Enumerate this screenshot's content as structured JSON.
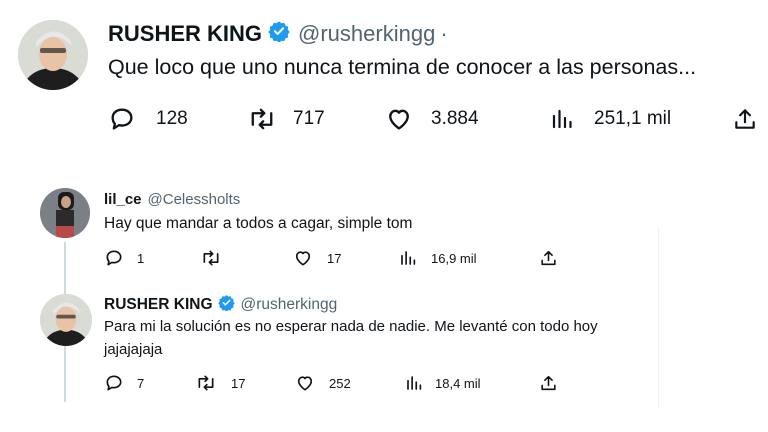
{
  "main_tweet": {
    "author_name": "RUSHER KING",
    "author_handle": "@rusherkingg",
    "dot": "·",
    "text": "Que loco que uno nunca termina de conocer a las personas...",
    "stats": {
      "replies": "128",
      "reposts": "717",
      "likes": "3.884",
      "views": "251,1 mil"
    }
  },
  "reply_1": {
    "author_name": "lil_ce",
    "author_handle": "@Celessholts",
    "text": "Hay que mandar a todos a cagar, simple tom",
    "stats": {
      "replies": "1",
      "reposts": "",
      "likes": "17",
      "views": "16,9 mil"
    }
  },
  "reply_2": {
    "author_name": "RUSHER KING",
    "author_handle": "@rusherkingg",
    "text_line1": "Para mi la solución es no esperar nada de nadie. Me levanté con todo hoy",
    "text_line2": "jajajajaja",
    "stats": {
      "replies": "7",
      "reposts": "17",
      "likes": "252",
      "views": "18,4 mil"
    }
  },
  "colors": {
    "verified": "#1d9bf0",
    "secondary_text": "#536471",
    "thread_line": "#cfd9de"
  },
  "icons": [
    "reply-icon",
    "repost-icon",
    "like-icon",
    "views-icon",
    "share-icon",
    "verified-badge-icon"
  ]
}
